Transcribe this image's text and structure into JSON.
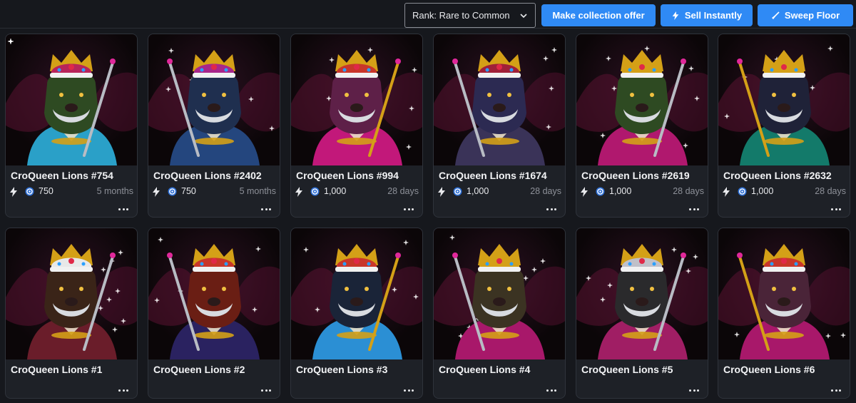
{
  "toolbar": {
    "sort_value": "Rank: Rare to Common",
    "collection_offer_label": "Make collection offer",
    "sell_label": "Sell Instantly",
    "sweep_label": "Sweep Floor"
  },
  "colors": {
    "accent": "#2f8af5",
    "card_bg": "#1e2127",
    "page_bg": "#16181d",
    "muted_text": "#8d9098"
  },
  "cards": [
    {
      "name": "CroQueen Lions #754",
      "price": "750",
      "age": "5 months",
      "listed": true,
      "fur": "#2e4a22",
      "robe": "#2aa0c8",
      "crown": "#b8245a"
    },
    {
      "name": "CroQueen Lions #2402",
      "price": "750",
      "age": "5 months",
      "listed": true,
      "fur": "#1f2f4f",
      "robe": "#24467e",
      "crown": "#a8268a"
    },
    {
      "name": "CroQueen Lions #994",
      "price": "1,000",
      "age": "28 days",
      "listed": true,
      "fur": "#5e2048",
      "robe": "#c2187a",
      "crown": "#c8362a"
    },
    {
      "name": "CroQueen Lions #1674",
      "price": "1,000",
      "age": "28 days",
      "listed": true,
      "fur": "#2c2a52",
      "robe": "#3a3358",
      "crown": "#a02038"
    },
    {
      "name": "CroQueen Lions #2619",
      "price": "1,000",
      "age": "28 days",
      "listed": true,
      "fur": "#2e4a22",
      "robe": "#b0186e",
      "crown": "#d4a017"
    },
    {
      "name": "CroQueen Lions #2632",
      "price": "1,000",
      "age": "28 days",
      "listed": true,
      "fur": "#1f2238",
      "robe": "#137a6a",
      "crown": "#d4a017"
    },
    {
      "name": "CroQueen Lions #1",
      "price": "",
      "age": "",
      "listed": false,
      "fur": "#3a2418",
      "robe": "#6a1d2a",
      "crown": "#e8e8e8"
    },
    {
      "name": "CroQueen Lions #2",
      "price": "",
      "age": "",
      "listed": false,
      "fur": "#6a1e14",
      "robe": "#2a2260",
      "crown": "#c8362a"
    },
    {
      "name": "CroQueen Lions #3",
      "price": "",
      "age": "",
      "listed": false,
      "fur": "#1a2438",
      "robe": "#2b8fd4",
      "crown": "#c8362a"
    },
    {
      "name": "CroQueen Lions #4",
      "price": "",
      "age": "",
      "listed": false,
      "fur": "#3b3322",
      "robe": "#a8186a",
      "crown": "#d4a017"
    },
    {
      "name": "CroQueen Lions #5",
      "price": "",
      "age": "",
      "listed": false,
      "fur": "#2a2a2c",
      "robe": "#a01e64",
      "crown": "#c0c0c8"
    },
    {
      "name": "CroQueen Lions #6",
      "price": "",
      "age": "",
      "listed": false,
      "fur": "#4a2438",
      "robe": "#a8186a",
      "crown": "#c8362a"
    }
  ]
}
